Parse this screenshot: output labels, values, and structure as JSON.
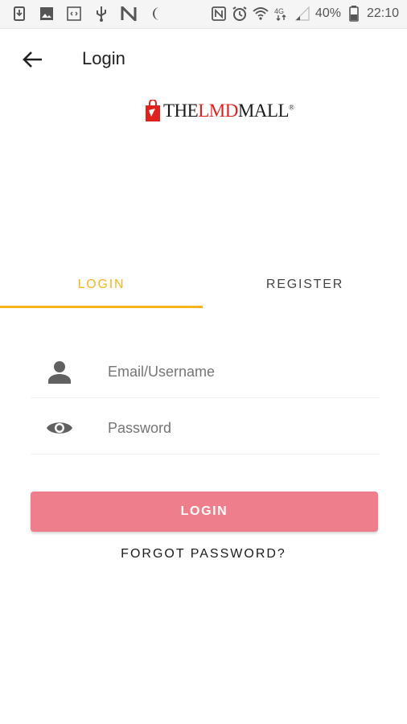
{
  "status_bar": {
    "battery_percent": "40%",
    "time": "22:10",
    "left_icons": [
      "download-icon",
      "image-icon",
      "code-icon",
      "usb-icon",
      "n-icon",
      "moon-icon"
    ],
    "right_icons": [
      "nfc-icon",
      "alarm-icon",
      "wifi-icon",
      "data-icon",
      "signal-icon",
      "battery-icon"
    ]
  },
  "app_bar": {
    "title": "Login"
  },
  "logo": {
    "prefix": "THE",
    "highlight": "LMD",
    "suffix": "MALL",
    "mark": "®"
  },
  "tabs": [
    {
      "label": "LOGIN",
      "selected": true
    },
    {
      "label": "REGISTER",
      "selected": false
    }
  ],
  "form": {
    "username": {
      "placeholder": "Email/Username",
      "value": ""
    },
    "password": {
      "placeholder": "Password",
      "value": ""
    }
  },
  "login_button": {
    "label": "LOGIN"
  },
  "forgot_password": {
    "label": "FORGOT PASSWORD?"
  },
  "colors": {
    "accent": "#f6b51e",
    "button": "#ef7e8c",
    "brand_red": "#e0221f"
  }
}
